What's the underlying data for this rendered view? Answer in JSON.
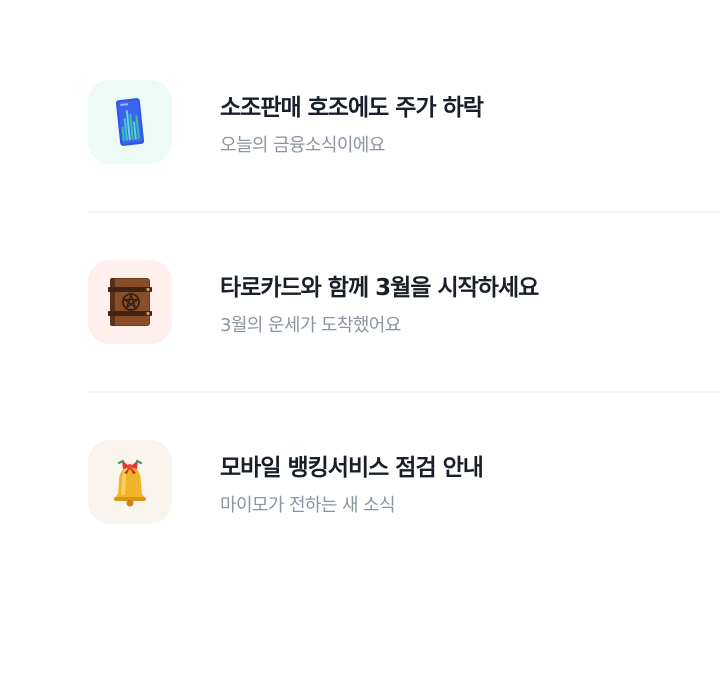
{
  "feed": {
    "items": [
      {
        "title": "소조판매 호조에도 주가 하락",
        "subtitle": "오늘의 금융소식이에요",
        "icon": "phone-chart-icon",
        "icon_bg": "#eefaf6"
      },
      {
        "title": "타로카드와 함께 3월을 시작하세요",
        "subtitle": "3월의 운세가 도착했어요",
        "icon": "spellbook-icon",
        "icon_bg": "#fff0ee"
      },
      {
        "title": "모바일 뱅킹서비스 점검 안내",
        "subtitle": "마이모가 전하는 새 소식",
        "icon": "bell-icon",
        "icon_bg": "#faf4ef"
      }
    ]
  }
}
